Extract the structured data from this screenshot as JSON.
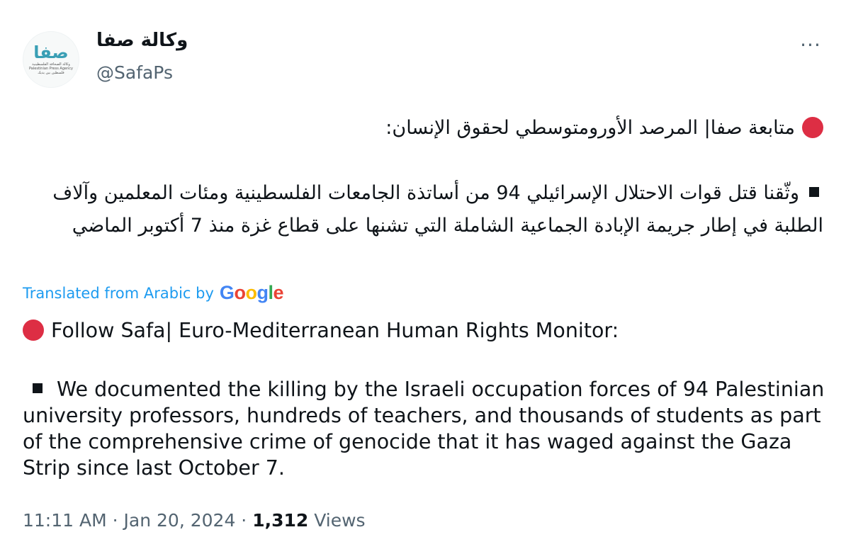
{
  "author": {
    "display_name": "وكالة صفا",
    "handle": "@SafaPs",
    "avatar_logo_text": "صفا",
    "avatar_logo_sub": "وكالة الصحافة الفلسطينية\nPalestinian Press Agency\nفلسطين بين يديك"
  },
  "more_menu_label": "···",
  "tweet": {
    "original_line1": "متابعة صفا| المرصد الأورومتوسطي لحقوق الإنسان:",
    "original_line2": "وثّقنا قتل قوات الاحتلال الإسرائيلي 94 من أساتذة الجامعات الفلسطينية ومئات المعلمين وآلاف الطلبة في إطار جريمة الإبادة الجماعية الشاملة التي تشنها على قطاع غزة منذ 7 أكتوبر الماضي",
    "translated_label": "Translated from Arabic by",
    "translator": "Google",
    "translation_line1": "Follow Safa| Euro-Mediterranean Human Rights Monitor:",
    "translation_line2": "We documented the killing by the Israeli occupation forces of 94 Palestinian university professors, hundreds of teachers, and thousands of students as part of the comprehensive crime of genocide that it has waged against the Gaza Strip since last October 7."
  },
  "meta": {
    "time": "11:11 AM",
    "separator": "·",
    "date": "Jan 20, 2024",
    "views_count": "1,312",
    "views_label": "Views"
  },
  "icons": {
    "red_circle": "red-circle-icon",
    "square": "black-square-icon",
    "more": "more-icon"
  },
  "colors": {
    "accent": "#1d9bf0",
    "red_circle": "#dd2e44",
    "secondary_text": "#536471"
  }
}
